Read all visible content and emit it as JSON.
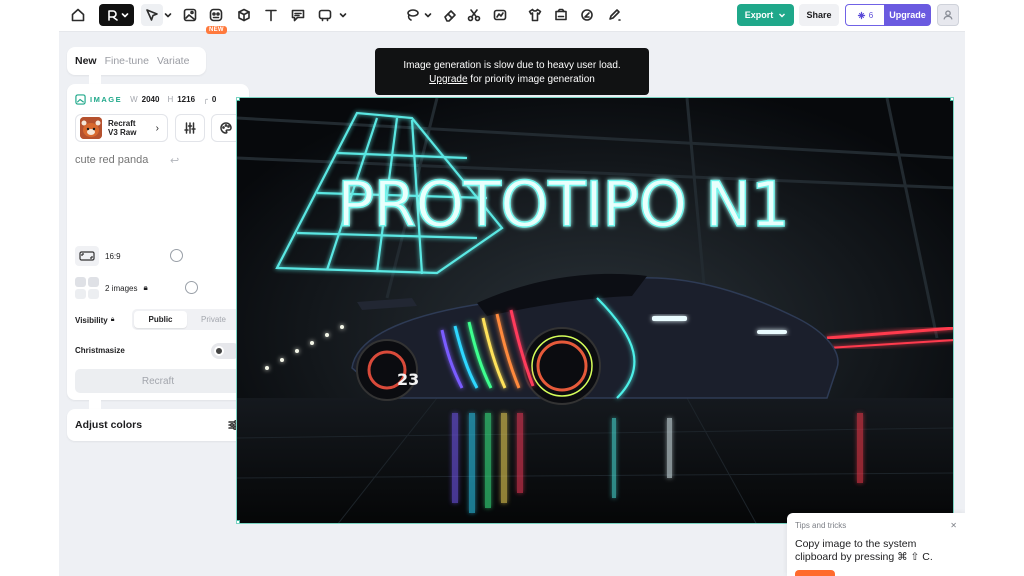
{
  "toolbar": {
    "export_label": "Export",
    "share_label": "Share",
    "credits": "6",
    "upgrade_label": "Upgrade",
    "new_badge": "NEW",
    "accent": "#1fa88a",
    "brand": "#6a5ae0",
    "tools": [
      "home-icon",
      "brand-style-icon",
      "select-arrow-icon",
      "image-icon",
      "generate-icon",
      "mockup-icon",
      "text-icon",
      "comment-icon",
      "frame-icon",
      "lasso-icon",
      "eraser-icon",
      "scissors-icon",
      "vectorize-icon",
      "shirt-icon",
      "mockup-edit-icon",
      "magic-icon",
      "edit-area-icon"
    ]
  },
  "mode_tabs": [
    "New",
    "Fine-tune",
    "Variate"
  ],
  "settings": {
    "image_label": "IMAGE",
    "w_label": "W",
    "width": "2040",
    "h_label": "H",
    "height": "1216",
    "corner_value": "0",
    "model_name_line1": "Recraft",
    "model_name_line2": "V3 Raw",
    "prompt": "cute red panda",
    "aspect_ratio": "16:9",
    "images_count": "2 images",
    "visibility_label": "Visibility",
    "visibility_public": "Public",
    "visibility_private": "Private",
    "christmasize_label": "Christmasize",
    "recraft_button": "Recraft"
  },
  "adjust_colors_label": "Adjust colors",
  "notice": {
    "line1": "Image generation is slow due to heavy user load.",
    "upgrade_link": "Upgrade",
    "line2_rest": " for priority image generation"
  },
  "canvas": {
    "headline": "PROTOTIPO N1",
    "car_number": "23"
  },
  "tips": {
    "title": "Tips and tricks",
    "body_line1": "Copy image to the system",
    "body_line2": "clipboard by pressing ⌘ ⇧ C."
  }
}
